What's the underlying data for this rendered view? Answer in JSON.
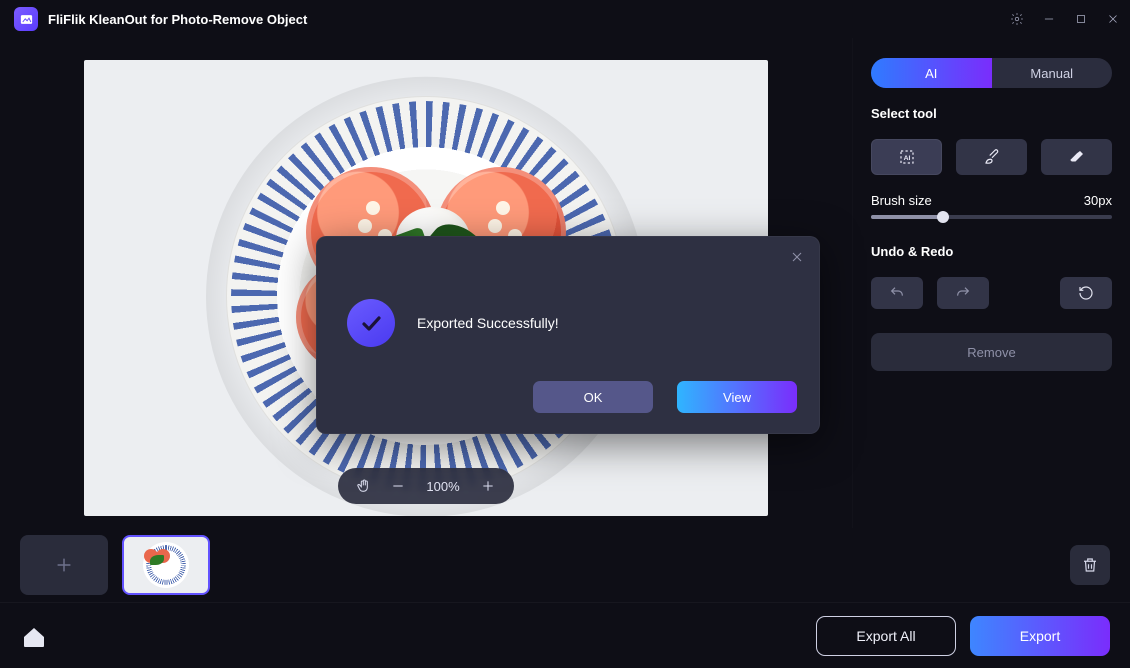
{
  "app": {
    "title": "FliFlik KleanOut for Photo-Remove Object"
  },
  "mode": {
    "ai": "AI",
    "manual": "Manual"
  },
  "sidebar": {
    "select_tool_label": "Select tool",
    "brush_size_label": "Brush size",
    "brush_size_value": "30px",
    "brush_size_percent": 30,
    "undo_redo_label": "Undo & Redo",
    "remove_label": "Remove"
  },
  "zoom": {
    "label": "100%"
  },
  "bottom": {
    "export_all": "Export All",
    "export": "Export"
  },
  "dialog": {
    "message": "Exported Successfully!",
    "ok": "OK",
    "view": "View"
  }
}
